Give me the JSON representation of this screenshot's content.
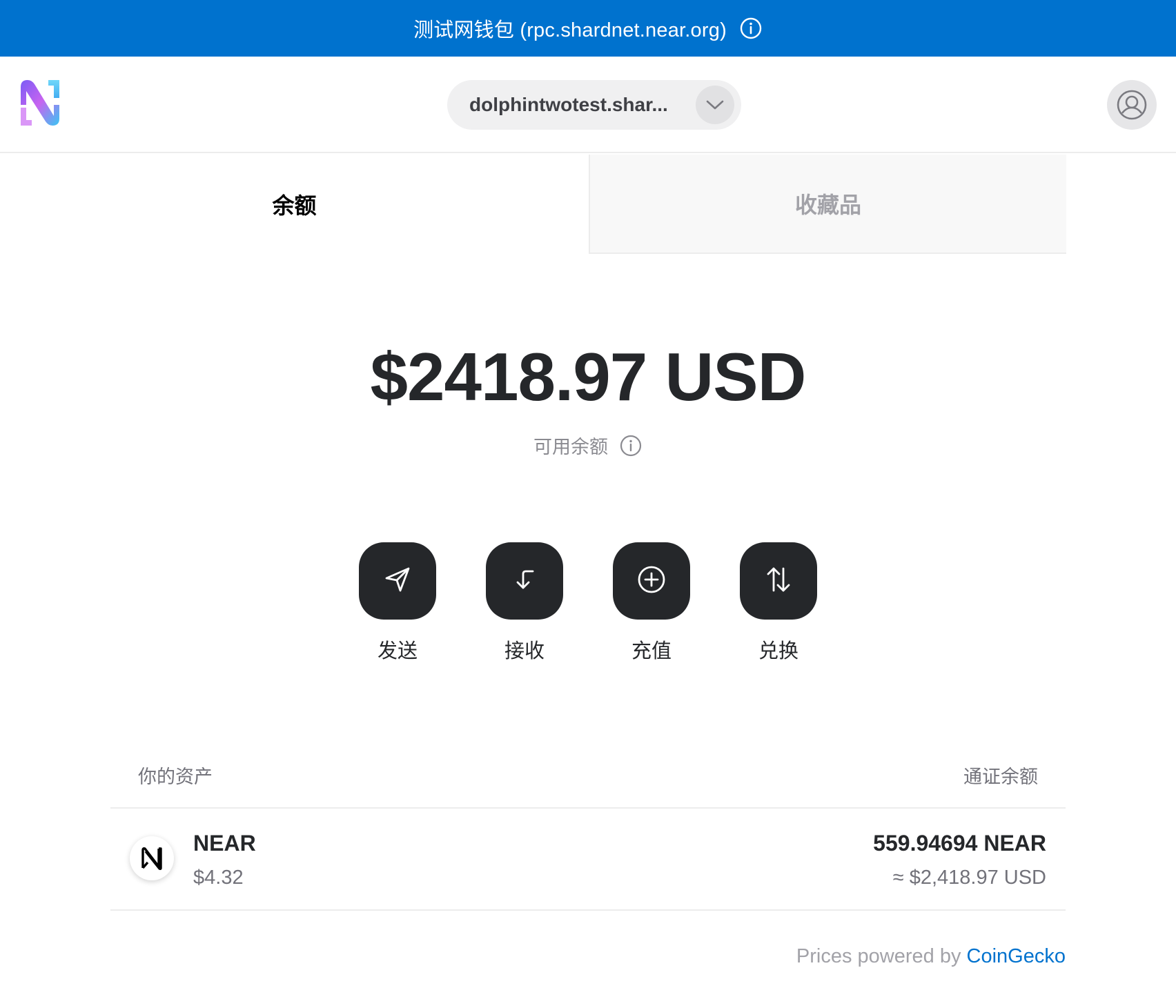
{
  "banner": {
    "text": "测试网钱包 (rpc.shardnet.near.org)",
    "icon": "info-icon"
  },
  "header": {
    "logo": "near-wallet-logo",
    "account": {
      "name": "dolphintwotest.shar...",
      "icon": "chevron-down-icon"
    },
    "profile_icon": "user-profile-icon"
  },
  "tabs": [
    {
      "label": "余额",
      "active": true
    },
    {
      "label": "收藏品",
      "active": false
    }
  ],
  "balance": {
    "total": "$2418.97 USD",
    "available_label": "可用余额",
    "info_icon": "info-icon"
  },
  "actions": [
    {
      "label": "发送",
      "icon": "send-icon"
    },
    {
      "label": "接收",
      "icon": "receive-icon"
    },
    {
      "label": "充值",
      "icon": "plus-circle-icon"
    },
    {
      "label": "兑换",
      "icon": "swap-icon"
    }
  ],
  "assets": {
    "header_left": "你的资产",
    "header_right": "通证余额",
    "items": [
      {
        "symbol": "NEAR",
        "price": "$4.32",
        "amount": "559.94694 NEAR",
        "fiat": "≈ $2,418.97 USD",
        "icon": "near-token-icon"
      }
    ]
  },
  "footer": {
    "prefix": "Prices powered by ",
    "link": "CoinGecko"
  },
  "colors": {
    "banner": "#0072ce",
    "button": "#25272a",
    "link": "#0072ce"
  }
}
